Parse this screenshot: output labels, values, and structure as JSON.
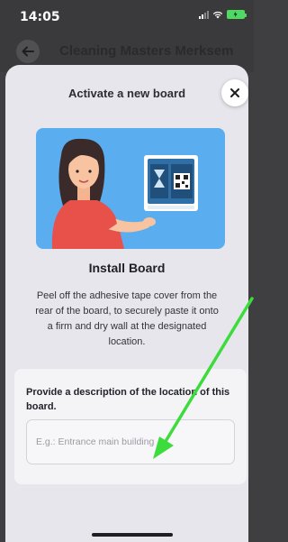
{
  "status_bar": {
    "time": "14:05",
    "icons": [
      "signal-icon",
      "wifi-icon",
      "battery-charging-icon"
    ],
    "battery_color": "#4cd964"
  },
  "header": {
    "title": "Cleaning Masters Merksem",
    "back_icon": "arrow-left-icon"
  },
  "sheet": {
    "title": "Activate a new board",
    "close_icon": "close-icon"
  },
  "illustration": {
    "background_color": "#5aaef0",
    "icon": "board-installation-illustration"
  },
  "install": {
    "title": "Install Board",
    "text": "Peel off the adhesive tape cover from the rear of the board, to securely paste it onto a firm and dry wall at the designated location."
  },
  "description": {
    "label": "Provide a description of the location of this board.",
    "placeholder": "E.g.: Entrance main building",
    "value": ""
  },
  "annotation": {
    "arrow_color": "#3ddc3d"
  }
}
